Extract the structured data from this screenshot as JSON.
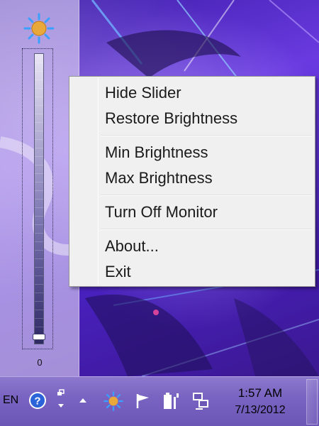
{
  "slider": {
    "value": "0",
    "level_fraction": 0
  },
  "context_menu": {
    "items": [
      {
        "label": "Hide Slider"
      },
      {
        "label": "Restore Brightness"
      },
      {
        "label": "Min Brightness"
      },
      {
        "label": "Max Brightness"
      },
      {
        "label": "Turn Off Monitor"
      },
      {
        "label": "About..."
      },
      {
        "label": "Exit"
      }
    ]
  },
  "taskbar": {
    "language": "EN",
    "icons": [
      "help-icon",
      "show-hidden-icons-icon",
      "brightness-tray-icon",
      "action-center-flag-icon",
      "power-battery-icon",
      "network-icon"
    ],
    "clock": {
      "time": "1:57 AM",
      "date": "7/13/2012"
    }
  },
  "colors": {
    "menu_background": "#f0f0f0",
    "sun_color": "#e8a83a",
    "sun_rays": "#3aa0ff",
    "wallpaper_accent": "#5a2dbd"
  }
}
